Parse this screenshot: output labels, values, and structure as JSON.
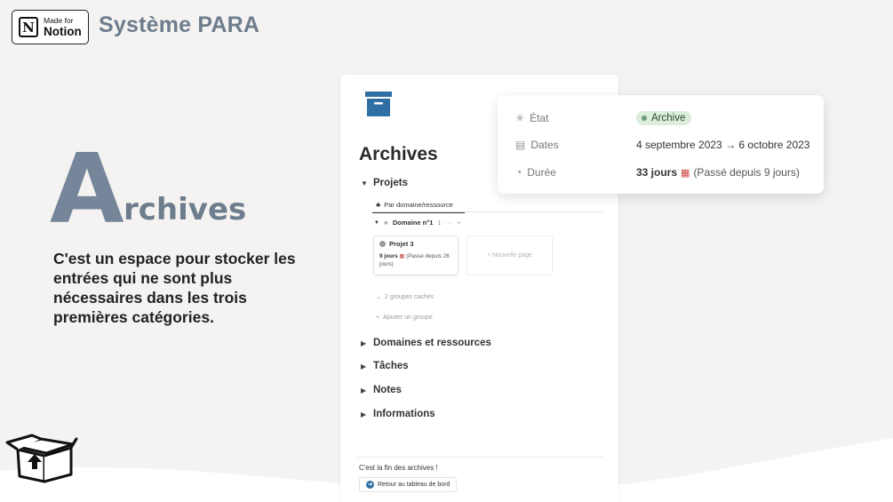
{
  "header": {
    "badge_small": "Made for",
    "badge_big": "Notion",
    "badge_logo_letter": "N",
    "site_title": "Système PARA"
  },
  "hero": {
    "title_initial": "A",
    "title_rest": "rchives",
    "description": "C'est un espace pour stocker les entrées qui ne sont plus nécessaires dans les trois premières catégories."
  },
  "page": {
    "icon": "archive-box-icon",
    "title": "Archives",
    "sections": {
      "projets": "Projets",
      "domaines": "Domaines et ressources",
      "taches": "Tâches",
      "notes": "Notes",
      "informations": "Informations"
    },
    "view_tab": "Par domaine/ressource",
    "group": {
      "name": "Domaine n°1",
      "count": "1",
      "more": "···",
      "add": "+"
    },
    "card": {
      "title": "Projet 3",
      "days": "9 jours",
      "meta": "(Passé depuis 26 jours)"
    },
    "new_page": "+ Nouvelle page",
    "hidden_groups": "2 groupes cachés",
    "add_group": "Ajouter un groupe",
    "footer_text": "C'est la fin des archives !",
    "footer_button": "Retour au tableau de bord"
  },
  "properties": {
    "etat_label": "État",
    "etat_value": "Archive",
    "dates_label": "Dates",
    "dates_value": "4 septembre 2023 → 6 octobre 2023",
    "duree_label": "Durée",
    "duree_days": "33 jours",
    "duree_note": "(Passé depuis 9 jours)"
  },
  "colors": {
    "accent_slate": "#6e7d8d",
    "archive_blue": "#2f6fa3",
    "status_green": "#dbeddb"
  }
}
